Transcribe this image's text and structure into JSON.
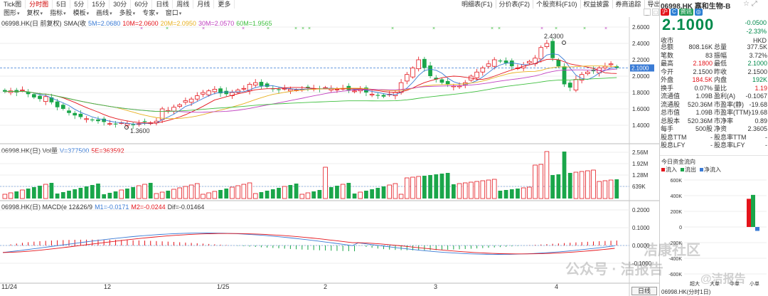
{
  "top_tabs": [
    "Tick图",
    "分时图",
    "5日",
    "5分",
    "15分",
    "30分",
    "60分",
    "日线",
    "周线",
    "月线",
    "更多"
  ],
  "active_tab": 1,
  "menu": [
    "图形",
    "复权",
    "指标",
    "模板",
    "画线",
    "多股",
    "专家",
    "窗口"
  ],
  "right_tools": [
    "明细表(F1)",
    "分价表(F2)",
    "个股资料(F10)",
    "权益披露",
    "券商追踪",
    "导出"
  ],
  "window_buttons": [
    "_",
    "□"
  ],
  "main_chart": {
    "header": [
      "06998.HK(日 前复权)",
      "SMA(收",
      "5M=2.0680",
      "10M=2.0600",
      "20M=2.0950",
      "30M=2.0570",
      "60M=1.9565"
    ],
    "y_ticks": [
      "2.6000",
      "2.4000",
      "2.2000",
      "2.1000",
      "2.0000",
      "1.8000",
      "1.6000",
      "1.4000"
    ],
    "current_price_label": "2.1000",
    "high_label": "2.4300",
    "low_label": "1.3600"
  },
  "vol_chart": {
    "header": [
      "06998.HK(日) Vol量",
      "V=377500",
      "5E=363592"
    ],
    "y_ticks": [
      "2.56M",
      "1.92M",
      "1.28M",
      "639K"
    ]
  },
  "macd_chart": {
    "header": [
      "06998.HK(日) MACD(e 12&26/9",
      "M1=-0.0171",
      "M2=-0.0244",
      "Dif=-0.01464"
    ],
    "y_ticks": [
      "0.2000",
      "0.1000",
      "0.0000",
      "-0.1000"
    ]
  },
  "x_labels": [
    "11/24",
    "12",
    "1/25",
    "2",
    "3",
    "4"
  ],
  "day_line_button": "日线",
  "quote": {
    "title": "06998.HK 嘉和生物-B",
    "icons": [
      "沪",
      "C",
      "资讯",
      "◎"
    ],
    "price": "2.1000",
    "change": "-0.0500",
    "change_pct": "-2.33%",
    "currency": "HKD",
    "close_label": "收市",
    "rows": [
      {
        "l1": "总额",
        "v1": "808.16K",
        "c1": "",
        "l2": "总量",
        "v2": "377.5K",
        "c2": ""
      },
      {
        "l1": "笔数",
        "v1": "83",
        "c1": "",
        "l2": "振幅",
        "v2": "3.72%",
        "c2": ""
      },
      {
        "l1": "最高",
        "v1": "2.1800",
        "c1": "red",
        "l2": "最低",
        "v2": "2.1000",
        "c2": "grn"
      },
      {
        "l1": "今开",
        "v1": "2.1500",
        "c1": "",
        "l2": "昨收",
        "v2": "2.1500",
        "c2": ""
      },
      {
        "l1": "外盘",
        "v1": "184.5K",
        "c1": "red",
        "l2": "内盘",
        "v2": "192K",
        "c2": "grn"
      },
      {
        "l1": "换手",
        "v1": "0.07%",
        "c1": "",
        "l2": "量比",
        "v2": "1.19",
        "c2": "red"
      },
      {
        "l1": "流通值",
        "v1": "1.09B",
        "c1": "",
        "l2": "盈利(A)",
        "v2": "-0.1067",
        "c2": ""
      },
      {
        "l1": "流通股",
        "v1": "520.36M",
        "c1": "",
        "l2": "市盈率(静)",
        "v2": "-19.68",
        "c2": ""
      },
      {
        "l1": "总市值",
        "v1": "1.09B",
        "c1": "",
        "l2": "市盈率(TTM)",
        "v2": "-19.68",
        "c2": ""
      },
      {
        "l1": "总股本",
        "v1": "520.36M",
        "c1": "",
        "l2": "市净率",
        "v2": "0.89",
        "c2": ""
      },
      {
        "l1": "每手",
        "v1": "500股",
        "c1": "",
        "l2": "净资",
        "v2": "2.3605",
        "c2": ""
      },
      {
        "l1": "股息TTM",
        "v1": "-",
        "c1": "",
        "l2": "股息率TTM",
        "v2": "-",
        "c2": ""
      },
      {
        "l1": "股息LFY",
        "v1": "-",
        "c1": "",
        "l2": "股息率LFY",
        "v2": "-",
        "c2": ""
      }
    ],
    "flow_title": "今日资金流向",
    "flow_legend": [
      "流入",
      "流出",
      "净流入"
    ],
    "flow_y_ticks": [
      "600K",
      "400K",
      "200K",
      "0",
      "-200K",
      "-400K",
      "-600K"
    ],
    "flow_x_labels": [
      "超大",
      "大单",
      "中单",
      "小单"
    ],
    "flow_bottom": "06998.HK(分时1日)",
    "colors": {
      "in": "#e4141b",
      "out": "#1aa64a",
      "net": "#3a7bd5"
    }
  },
  "watermarks": [
    "公众号 · 洁报告",
    "@洁报告",
    "洁康社区"
  ]
}
